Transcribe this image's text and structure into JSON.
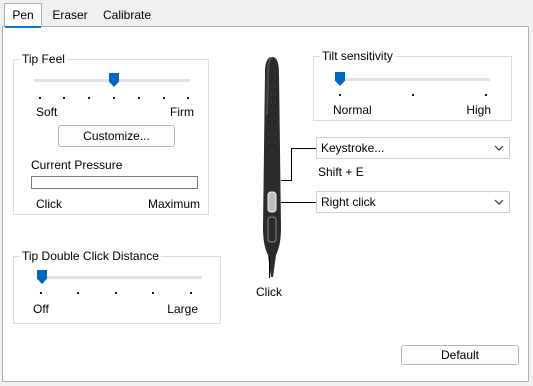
{
  "tabs": [
    {
      "label": "Pen",
      "active": true
    },
    {
      "label": "Eraser",
      "active": false
    },
    {
      "label": "Calibrate",
      "active": false
    }
  ],
  "tip_feel": {
    "title": "Tip Feel",
    "min_label": "Soft",
    "max_label": "Firm",
    "slider_value": 0.5,
    "customize_label": "Customize...",
    "current_pressure_label": "Current Pressure",
    "pressure_level": 0,
    "click_label": "Click",
    "maximum_label": "Maximum"
  },
  "tilt": {
    "title": "Tilt sensitivity",
    "min_label": "Normal",
    "max_label": "High",
    "slider_value": 0
  },
  "tip_double_click": {
    "title": "Tip Double Click Distance",
    "min_label": "Off",
    "max_label": "Large",
    "slider_value": 0
  },
  "pen_buttons": {
    "upper_value": "Keystroke...",
    "upper_detail": "Shift + E",
    "lower_value": "Right click",
    "tip_label": "Click"
  },
  "default_label": "Default",
  "colors": {
    "accent": "#0067c0",
    "tab_underline": "#0078d4",
    "pen_body": "#2b2b2b"
  }
}
